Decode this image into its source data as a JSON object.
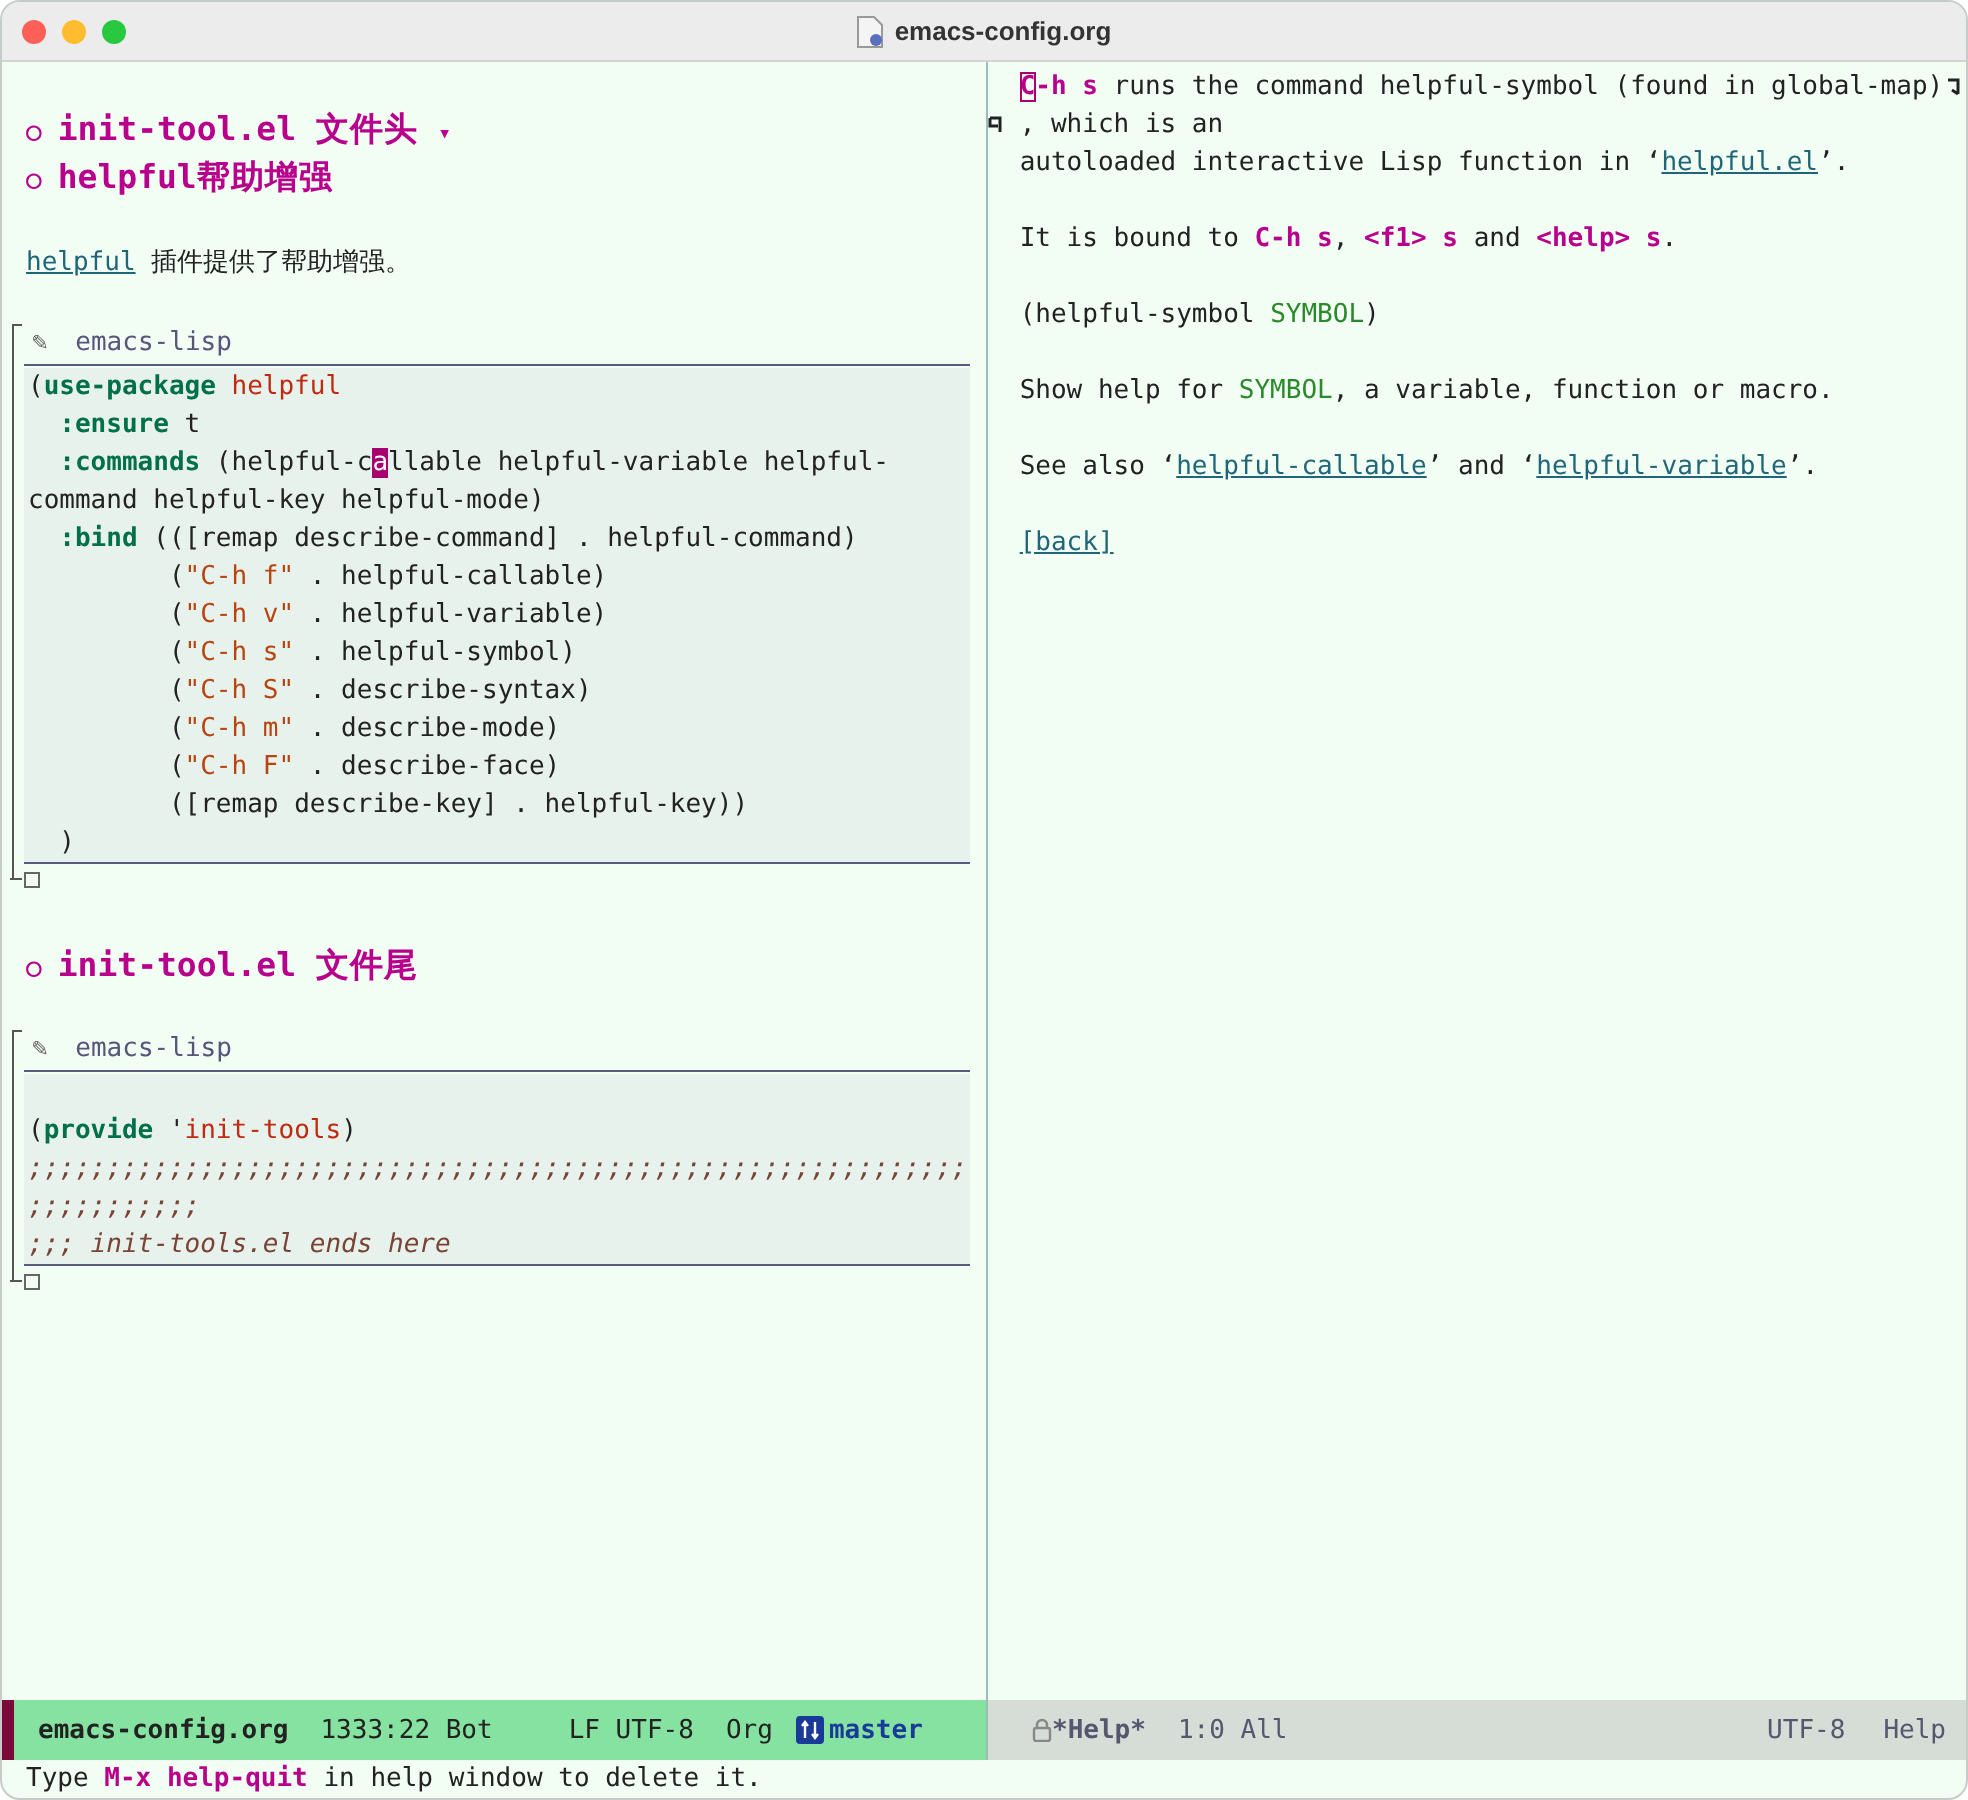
{
  "window": {
    "title": "emacs-config.org"
  },
  "left_pane": {
    "items": [
      {
        "kind": "heading",
        "bullet": "○",
        "text": "init-tool.el 文件头",
        "folded_marker": "▾"
      },
      {
        "kind": "heading",
        "bullet": "○",
        "text": "helpful帮助增强"
      },
      {
        "kind": "paragraph",
        "segments": [
          {
            "kind": "link",
            "text": "helpful"
          },
          {
            "kind": "plain",
            "text": " 插件提供了帮助增强。"
          }
        ]
      },
      {
        "kind": "src",
        "icon": "✎",
        "language": "emacs-lisp",
        "lines": [
          {
            "tokens": [
              {
                "kind": "plain",
                "text": "("
              },
              {
                "kind": "keyword",
                "text": "use-package"
              },
              {
                "kind": "constant",
                "text": " helpful"
              }
            ]
          },
          {
            "tokens": [
              {
                "kind": "keyword",
                "text": "  :ensure"
              },
              {
                "kind": "plain",
                "text": " t"
              }
            ]
          },
          {
            "tokens": [
              {
                "kind": "keyword",
                "text": "  :commands"
              },
              {
                "kind": "plain",
                "text": " (helpful-c"
              },
              {
                "kind": "cursor",
                "text": "a"
              },
              {
                "kind": "plain",
                "text": "llable helpful-variable helpful-command helpful-key helpful-mode)"
              }
            ]
          },
          {
            "tokens": [
              {
                "kind": "keyword",
                "text": "  :bind"
              },
              {
                "kind": "plain",
                "text": " (([remap describe-command] . helpful-command)"
              }
            ]
          },
          {
            "tokens": [
              {
                "kind": "plain",
                "text": "         ("
              },
              {
                "kind": "string",
                "text": "\"C-h f\""
              },
              {
                "kind": "plain",
                "text": " . helpful-callable)"
              }
            ]
          },
          {
            "tokens": [
              {
                "kind": "plain",
                "text": "         ("
              },
              {
                "kind": "string",
                "text": "\"C-h v\""
              },
              {
                "kind": "plain",
                "text": " . helpful-variable)"
              }
            ]
          },
          {
            "tokens": [
              {
                "kind": "plain",
                "text": "         ("
              },
              {
                "kind": "string",
                "text": "\"C-h s\""
              },
              {
                "kind": "plain",
                "text": " . helpful-symbol)"
              }
            ]
          },
          {
            "tokens": [
              {
                "kind": "plain",
                "text": "         ("
              },
              {
                "kind": "string",
                "text": "\"C-h S\""
              },
              {
                "kind": "plain",
                "text": " . describe-syntax)"
              }
            ]
          },
          {
            "tokens": [
              {
                "kind": "plain",
                "text": "         ("
              },
              {
                "kind": "string",
                "text": "\"C-h m\""
              },
              {
                "kind": "plain",
                "text": " . describe-mode)"
              }
            ]
          },
          {
            "tokens": [
              {
                "kind": "plain",
                "text": "         ("
              },
              {
                "kind": "string",
                "text": "\"C-h F\""
              },
              {
                "kind": "plain",
                "text": " . describe-face)"
              }
            ]
          },
          {
            "tokens": [
              {
                "kind": "plain",
                "text": "         ([remap describe-key] . helpful-key))"
              }
            ]
          },
          {
            "tokens": [
              {
                "kind": "plain",
                "text": "  )"
              }
            ]
          }
        ]
      },
      {
        "kind": "heading",
        "bullet": "○",
        "text": "init-tool.el 文件尾"
      },
      {
        "kind": "src",
        "icon": "✎",
        "language": "emacs-lisp",
        "lines": [
          {
            "kind": "blank"
          },
          {
            "tokens": [
              {
                "kind": "plain",
                "text": "("
              },
              {
                "kind": "keyword",
                "text": "provide"
              },
              {
                "kind": "plain",
                "text": " '"
              },
              {
                "kind": "constant",
                "text": "init-tools"
              },
              {
                "kind": "plain",
                "text": ")"
              }
            ]
          },
          {
            "tokens": [
              {
                "kind": "comment",
                "text": ";;;;;;;;;;;;;;;;;;;;;;;;;;;;;;;;;;;;;;;;;;;;;;;;;;;;;;;;;;;;;;;;;;;;;;;"
              }
            ]
          },
          {
            "tokens": [
              {
                "kind": "comment",
                "text": ";;; init-tools.el ends here"
              }
            ]
          }
        ]
      }
    ]
  },
  "help_pane": {
    "paragraphs": [
      {
        "lines": [
          {
            "wrapped": true,
            "segments": [
              {
                "kind": "cursor-key",
                "text": "C"
              },
              {
                "kind": "key",
                "text": "-h s"
              },
              {
                "kind": "plain",
                "text": " runs the command helpful-symbol (found in global-map)"
              }
            ]
          },
          {
            "segments": [
              {
                "kind": "plain",
                "text": ", which is an"
              }
            ]
          },
          {
            "segments": [
              {
                "kind": "plain",
                "text": "autoloaded interactive Lisp function in ‘"
              },
              {
                "kind": "link",
                "text": "helpful.el"
              },
              {
                "kind": "plain",
                "text": "’."
              }
            ]
          }
        ]
      },
      {
        "lines": [
          {
            "segments": [
              {
                "kind": "plain",
                "text": "It is bound to "
              },
              {
                "kind": "key",
                "text": "C-h s"
              },
              {
                "kind": "plain",
                "text": ", "
              },
              {
                "kind": "key",
                "text": "<f1> s"
              },
              {
                "kind": "plain",
                "text": " and "
              },
              {
                "kind": "key",
                "text": "<help> s"
              },
              {
                "kind": "plain",
                "text": "."
              }
            ]
          }
        ]
      },
      {
        "lines": [
          {
            "segments": [
              {
                "kind": "plain",
                "text": "(helpful-symbol "
              },
              {
                "kind": "arg",
                "text": "SYMBOL"
              },
              {
                "kind": "plain",
                "text": ")"
              }
            ]
          }
        ]
      },
      {
        "lines": [
          {
            "segments": [
              {
                "kind": "plain",
                "text": "Show help for "
              },
              {
                "kind": "arg",
                "text": "SYMBOL"
              },
              {
                "kind": "plain",
                "text": ", a variable, function or macro."
              }
            ]
          }
        ]
      },
      {
        "lines": [
          {
            "segments": [
              {
                "kind": "plain",
                "text": "See also ‘"
              },
              {
                "kind": "link",
                "text": "helpful-callable"
              },
              {
                "kind": "plain",
                "text": "’ and ‘"
              },
              {
                "kind": "link",
                "text": "helpful-variable"
              },
              {
                "kind": "plain",
                "text": "’."
              }
            ]
          }
        ]
      },
      {
        "lines": [
          {
            "segments": [
              {
                "kind": "button",
                "text": "[back]"
              }
            ]
          }
        ]
      }
    ]
  },
  "mode_lines": [
    {
      "active": true,
      "items": [
        {
          "kind": "buffer",
          "text": "emacs-config.org"
        },
        {
          "kind": "position",
          "text": "1333:22 Bot"
        },
        {
          "kind": "encoding",
          "text": "LF UTF-8"
        },
        {
          "kind": "mode",
          "text": "Org"
        },
        {
          "kind": "branch",
          "text": "master"
        }
      ]
    },
    {
      "active": false,
      "items": [
        {
          "kind": "buffer",
          "text": "*Help*",
          "read_only": true
        },
        {
          "kind": "position",
          "text": "1:0 All"
        }
      ],
      "right_items": [
        {
          "kind": "encoding",
          "text": "UTF-8"
        },
        {
          "kind": "mode",
          "text": "Help"
        }
      ]
    }
  ],
  "echo_area": {
    "segments": [
      {
        "kind": "plain",
        "text": "Type "
      },
      {
        "kind": "key",
        "text": "M-x help-quit"
      },
      {
        "kind": "plain",
        "text": " in help window to delete it."
      }
    ]
  }
}
